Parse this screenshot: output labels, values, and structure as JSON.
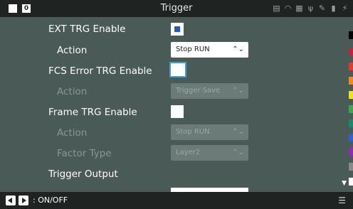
{
  "header": {
    "title": "Trigger",
    "badge": "0"
  },
  "status_icons": [
    "printer-icon",
    "wifi-icon",
    "network-icon",
    "usb-icon",
    "pen-icon",
    "sd-card-icon",
    "power-plug-icon"
  ],
  "settings": {
    "ext_trg": {
      "label": "EXT TRG Enable",
      "checked": true,
      "action_label": "Action",
      "action_value": "Stop RUN"
    },
    "fcs_trg": {
      "label": "FCS Error TRG Enable",
      "checked": false,
      "action_label": "Action",
      "action_value": "Trigger Save"
    },
    "frame_trg": {
      "label": "Frame TRG Enable",
      "checked": false,
      "action_label": "Action",
      "action_value": "Stop RUN",
      "factor_label": "Factor Type",
      "factor_value": "Layer2"
    },
    "trigger_output": {
      "label": "Trigger Output"
    }
  },
  "color_strip": [
    "#000000",
    "#c8213b",
    "#e03a2c",
    "#f08a22",
    "#f2e21a",
    "#3aa84a",
    "#1a8a6a",
    "#2b63c6",
    "#8a2fb0",
    "#8a8a8a",
    "#ffffff"
  ],
  "footer": {
    "hint": ": ON/OFF"
  }
}
